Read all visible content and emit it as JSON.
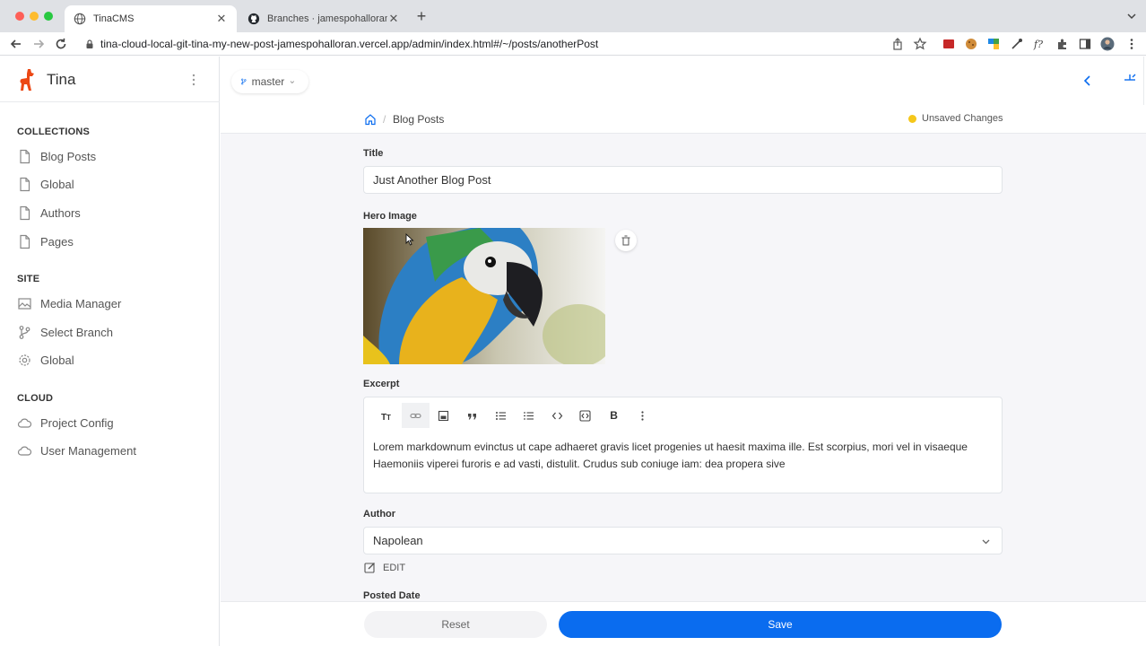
{
  "browser": {
    "tabs": [
      {
        "title": "TinaCMS",
        "favicon": "globe-icon",
        "active": true
      },
      {
        "title": "Branches · jamespohalloran/tina-cloud-starter",
        "favicon": "github-icon",
        "active": false
      }
    ],
    "url": "tina-cloud-local-git-tina-my-new-post-jamespohalloran.vercel.app/admin/index.html#/~/posts/anotherPost"
  },
  "sidebar": {
    "brand": "Tina",
    "sections": [
      {
        "heading": "COLLECTIONS",
        "items": [
          {
            "label": "Blog Posts",
            "icon": "file-icon"
          },
          {
            "label": "Global",
            "icon": "file-icon"
          },
          {
            "label": "Authors",
            "icon": "file-icon"
          },
          {
            "label": "Pages",
            "icon": "file-icon"
          }
        ]
      },
      {
        "heading": "SITE",
        "items": [
          {
            "label": "Media Manager",
            "icon": "image-icon"
          },
          {
            "label": "Select Branch",
            "icon": "branch-icon"
          },
          {
            "label": "Global",
            "icon": "gear-icon"
          }
        ]
      },
      {
        "heading": "CLOUD",
        "items": [
          {
            "label": "Project Config",
            "icon": "cloud-icon"
          },
          {
            "label": "User Management",
            "icon": "cloud-icon"
          }
        ]
      }
    ]
  },
  "branch": {
    "name": "master"
  },
  "breadcrumb": {
    "current": "Blog Posts"
  },
  "status": {
    "text": "Unsaved Changes",
    "color": "#f5c71a"
  },
  "form": {
    "title_label": "Title",
    "title_value": "Just Another Blog Post",
    "hero_label": "Hero Image",
    "excerpt_label": "Excerpt",
    "excerpt_toolbar": [
      "text-size-icon",
      "link-icon",
      "image-icon",
      "quote-icon",
      "bullet-list-icon",
      "numbered-list-icon",
      "code-icon",
      "code-block-icon",
      "bold-icon",
      "more-icon"
    ],
    "bold_glyph": "B",
    "excerpt_text": "Lorem markdownum evinctus ut cape adhaeret gravis licet progenies ut haesit maxima ille. Est scorpius, mori vel in visaeque Haemoniis viperei furoris e ad vasti, distulit. Crudus sub coniuge iam: dea propera sive",
    "author_label": "Author",
    "author_value": "Napolean",
    "edit_label": "EDIT",
    "posted_label": "Posted Date"
  },
  "footer": {
    "reset_label": "Reset",
    "save_label": "Save"
  },
  "colors": {
    "accent": "#0a6cef",
    "brand": "#ec4815"
  }
}
